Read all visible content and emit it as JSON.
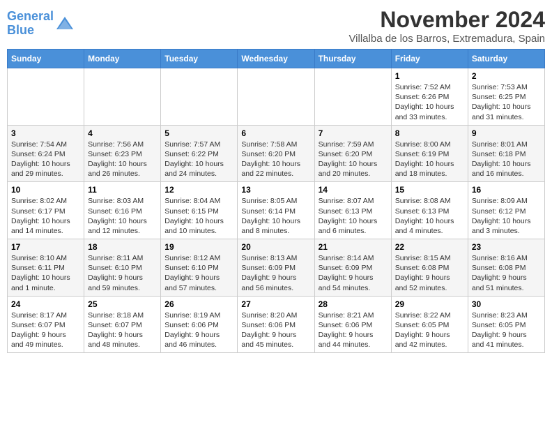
{
  "header": {
    "logo_line1": "General",
    "logo_line2": "Blue",
    "month": "November 2024",
    "location": "Villalba de los Barros, Extremadura, Spain"
  },
  "days_of_week": [
    "Sunday",
    "Monday",
    "Tuesday",
    "Wednesday",
    "Thursday",
    "Friday",
    "Saturday"
  ],
  "weeks": [
    [
      {
        "day": "",
        "info": ""
      },
      {
        "day": "",
        "info": ""
      },
      {
        "day": "",
        "info": ""
      },
      {
        "day": "",
        "info": ""
      },
      {
        "day": "",
        "info": ""
      },
      {
        "day": "1",
        "info": "Sunrise: 7:52 AM\nSunset: 6:26 PM\nDaylight: 10 hours and 33 minutes."
      },
      {
        "day": "2",
        "info": "Sunrise: 7:53 AM\nSunset: 6:25 PM\nDaylight: 10 hours and 31 minutes."
      }
    ],
    [
      {
        "day": "3",
        "info": "Sunrise: 7:54 AM\nSunset: 6:24 PM\nDaylight: 10 hours and 29 minutes."
      },
      {
        "day": "4",
        "info": "Sunrise: 7:56 AM\nSunset: 6:23 PM\nDaylight: 10 hours and 26 minutes."
      },
      {
        "day": "5",
        "info": "Sunrise: 7:57 AM\nSunset: 6:22 PM\nDaylight: 10 hours and 24 minutes."
      },
      {
        "day": "6",
        "info": "Sunrise: 7:58 AM\nSunset: 6:20 PM\nDaylight: 10 hours and 22 minutes."
      },
      {
        "day": "7",
        "info": "Sunrise: 7:59 AM\nSunset: 6:20 PM\nDaylight: 10 hours and 20 minutes."
      },
      {
        "day": "8",
        "info": "Sunrise: 8:00 AM\nSunset: 6:19 PM\nDaylight: 10 hours and 18 minutes."
      },
      {
        "day": "9",
        "info": "Sunrise: 8:01 AM\nSunset: 6:18 PM\nDaylight: 10 hours and 16 minutes."
      }
    ],
    [
      {
        "day": "10",
        "info": "Sunrise: 8:02 AM\nSunset: 6:17 PM\nDaylight: 10 hours and 14 minutes."
      },
      {
        "day": "11",
        "info": "Sunrise: 8:03 AM\nSunset: 6:16 PM\nDaylight: 10 hours and 12 minutes."
      },
      {
        "day": "12",
        "info": "Sunrise: 8:04 AM\nSunset: 6:15 PM\nDaylight: 10 hours and 10 minutes."
      },
      {
        "day": "13",
        "info": "Sunrise: 8:05 AM\nSunset: 6:14 PM\nDaylight: 10 hours and 8 minutes."
      },
      {
        "day": "14",
        "info": "Sunrise: 8:07 AM\nSunset: 6:13 PM\nDaylight: 10 hours and 6 minutes."
      },
      {
        "day": "15",
        "info": "Sunrise: 8:08 AM\nSunset: 6:13 PM\nDaylight: 10 hours and 4 minutes."
      },
      {
        "day": "16",
        "info": "Sunrise: 8:09 AM\nSunset: 6:12 PM\nDaylight: 10 hours and 3 minutes."
      }
    ],
    [
      {
        "day": "17",
        "info": "Sunrise: 8:10 AM\nSunset: 6:11 PM\nDaylight: 10 hours and 1 minute."
      },
      {
        "day": "18",
        "info": "Sunrise: 8:11 AM\nSunset: 6:10 PM\nDaylight: 9 hours and 59 minutes."
      },
      {
        "day": "19",
        "info": "Sunrise: 8:12 AM\nSunset: 6:10 PM\nDaylight: 9 hours and 57 minutes."
      },
      {
        "day": "20",
        "info": "Sunrise: 8:13 AM\nSunset: 6:09 PM\nDaylight: 9 hours and 56 minutes."
      },
      {
        "day": "21",
        "info": "Sunrise: 8:14 AM\nSunset: 6:09 PM\nDaylight: 9 hours and 54 minutes."
      },
      {
        "day": "22",
        "info": "Sunrise: 8:15 AM\nSunset: 6:08 PM\nDaylight: 9 hours and 52 minutes."
      },
      {
        "day": "23",
        "info": "Sunrise: 8:16 AM\nSunset: 6:08 PM\nDaylight: 9 hours and 51 minutes."
      }
    ],
    [
      {
        "day": "24",
        "info": "Sunrise: 8:17 AM\nSunset: 6:07 PM\nDaylight: 9 hours and 49 minutes."
      },
      {
        "day": "25",
        "info": "Sunrise: 8:18 AM\nSunset: 6:07 PM\nDaylight: 9 hours and 48 minutes."
      },
      {
        "day": "26",
        "info": "Sunrise: 8:19 AM\nSunset: 6:06 PM\nDaylight: 9 hours and 46 minutes."
      },
      {
        "day": "27",
        "info": "Sunrise: 8:20 AM\nSunset: 6:06 PM\nDaylight: 9 hours and 45 minutes."
      },
      {
        "day": "28",
        "info": "Sunrise: 8:21 AM\nSunset: 6:06 PM\nDaylight: 9 hours and 44 minutes."
      },
      {
        "day": "29",
        "info": "Sunrise: 8:22 AM\nSunset: 6:05 PM\nDaylight: 9 hours and 42 minutes."
      },
      {
        "day": "30",
        "info": "Sunrise: 8:23 AM\nSunset: 6:05 PM\nDaylight: 9 hours and 41 minutes."
      }
    ]
  ]
}
